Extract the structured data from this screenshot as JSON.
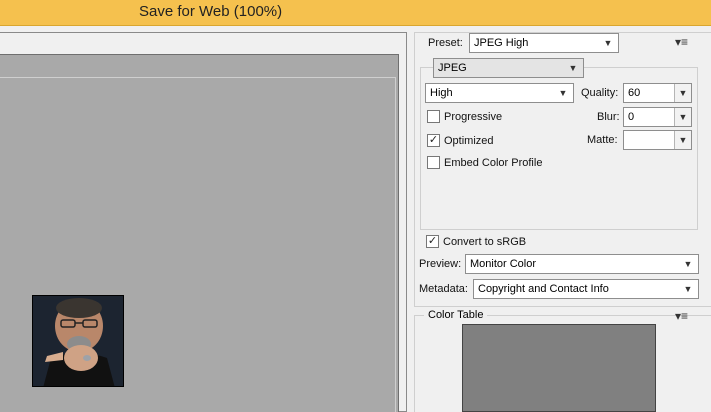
{
  "window": {
    "title": "Save for Web (100%)"
  },
  "settings": {
    "preset_label": "Preset:",
    "preset_value": "JPEG High",
    "format_value": "JPEG",
    "quality_preset_value": "High",
    "quality_label": "Quality:",
    "quality_value": "60",
    "progressive_label": "Progressive",
    "progressive_checked": false,
    "blur_label": "Blur:",
    "blur_value": "0",
    "optimized_label": "Optimized",
    "optimized_checked": true,
    "matte_label": "Matte:",
    "matte_value": "",
    "embed_profile_label": "Embed Color Profile",
    "embed_profile_checked": false,
    "convert_srgb_label": "Convert to sRGB",
    "convert_srgb_checked": true,
    "preview_label": "Preview:",
    "preview_value": "Monitor Color",
    "metadata_label": "Metadata:",
    "metadata_value": "Copyright and Contact Info",
    "menu_icon": "panel-menu-icon"
  },
  "color_table": {
    "title": "Color Table",
    "swatch_color": "#808080",
    "menu_icon": "panel-menu-icon"
  },
  "colors": {
    "titlebar": "#f5c14e",
    "canvas": "#a9a9a9",
    "panel": "#f0f0f0"
  }
}
